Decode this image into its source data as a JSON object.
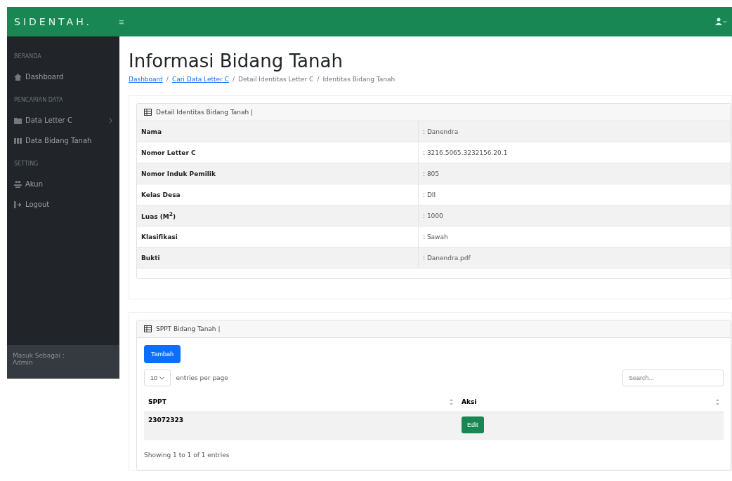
{
  "navbar": {
    "brand": "SIDENTAH.",
    "toggle": "≡"
  },
  "sidebar": {
    "sections": [
      {
        "heading": "BERANDA",
        "items": [
          {
            "label": "Dashboard",
            "expandable": false
          }
        ]
      },
      {
        "heading": "PENCARIAN DATA",
        "items": [
          {
            "label": "Data Letter C",
            "expandable": true
          },
          {
            "label": "Data Bidang Tanah",
            "expandable": false
          }
        ]
      },
      {
        "heading": "SETTING",
        "items": [
          {
            "label": "Akun",
            "expandable": false
          },
          {
            "label": "Logout",
            "expandable": false
          }
        ]
      }
    ],
    "footer": {
      "label": "Masuk Sebagai :",
      "user": "Admin"
    }
  },
  "page": {
    "title": "Informasi Bidang Tanah",
    "separator": "/",
    "breadcrumb": [
      {
        "label": "Dashboard",
        "link": true
      },
      {
        "label": "Cari Data Letter C",
        "link": true
      },
      {
        "label": "Detail Identitas Letter C",
        "link": false
      },
      {
        "label": "Identitas Bidang Tanah",
        "link": false
      }
    ]
  },
  "detail": {
    "header": "Detail Identitas Bidang Tanah |",
    "rows": [
      {
        "label": "Nama",
        "value": ": Danendra"
      },
      {
        "label": "Nomor Letter C",
        "value": ": 3216.5065.3232156.20.1"
      },
      {
        "label": "Nomor Induk Pemilik",
        "value": ": 805"
      },
      {
        "label": "Kelas Desa",
        "value": ": DII"
      },
      {
        "label": "Luas (M$^{2}$)",
        "value": ": 1000"
      },
      {
        "label": "Klasifikasi",
        "value": ": Sawah"
      },
      {
        "label": "Bukti",
        "value": ": Danendra.pdf"
      }
    ]
  },
  "sppt": {
    "header": "SPPT Bidang Tanah |",
    "add_button": "Tambah",
    "per_page": "10",
    "per_page_label": "entries per page",
    "search": {
      "placeholder": "Search..."
    },
    "columns": [
      "SPPT",
      "Aksi"
    ],
    "rows": [
      {
        "sppt": "23072323",
        "action": "Edit"
      }
    ],
    "info": "Showing 1 to 1 of 1 entries"
  }
}
